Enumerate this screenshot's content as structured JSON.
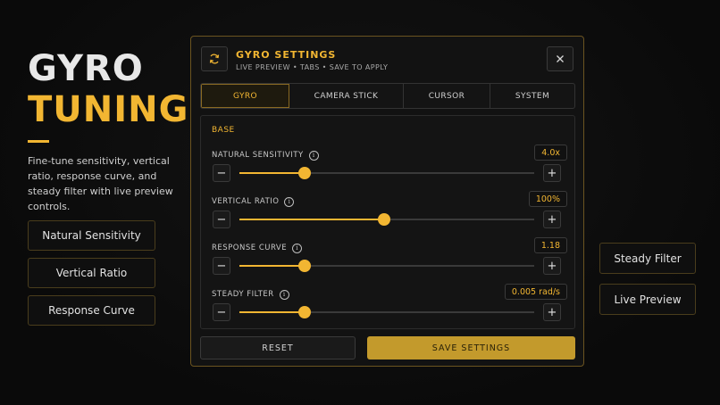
{
  "hero": {
    "title_line1": "GYRO",
    "title_line2": "TUNING",
    "description": "Fine-tune sensitivity, vertical ratio, response curve, and steady filter with live preview controls."
  },
  "left_buttons": [
    "Natural Sensitivity",
    "Vertical Ratio",
    "Response Curve"
  ],
  "right_buttons": [
    "Steady Filter",
    "Live Preview"
  ],
  "panel": {
    "title": "GYRO SETTINGS",
    "subtitle": "LIVE PREVIEW • TABS • SAVE TO APPLY",
    "header_icon": "refresh-icon",
    "close_icon": "close-icon",
    "tabs": [
      {
        "label": "GYRO",
        "active": true
      },
      {
        "label": "CAMERA STICK",
        "active": false
      },
      {
        "label": "CURSOR",
        "active": false
      },
      {
        "label": "SYSTEM",
        "active": false
      }
    ],
    "section_label": "BASE",
    "params": [
      {
        "label": "NATURAL SENSITIVITY",
        "value": "4.0x",
        "level": 0.22
      },
      {
        "label": "VERTICAL RATIO",
        "value": "100%",
        "level": 0.49
      },
      {
        "label": "RESPONSE CURVE",
        "value": "1.18",
        "level": 0.22
      },
      {
        "label": "STEADY FILTER",
        "value": "0.005 rad/s",
        "level": 0.22
      }
    ],
    "decrement_symbol": "−",
    "increment_symbol": "+",
    "reset_label": "RESET",
    "save_label": "SAVE SETTINGS"
  },
  "colors": {
    "accent": "#f2b632",
    "background": "#0c0c0c",
    "panel": "#121212",
    "save_button": "#c39a2c"
  }
}
